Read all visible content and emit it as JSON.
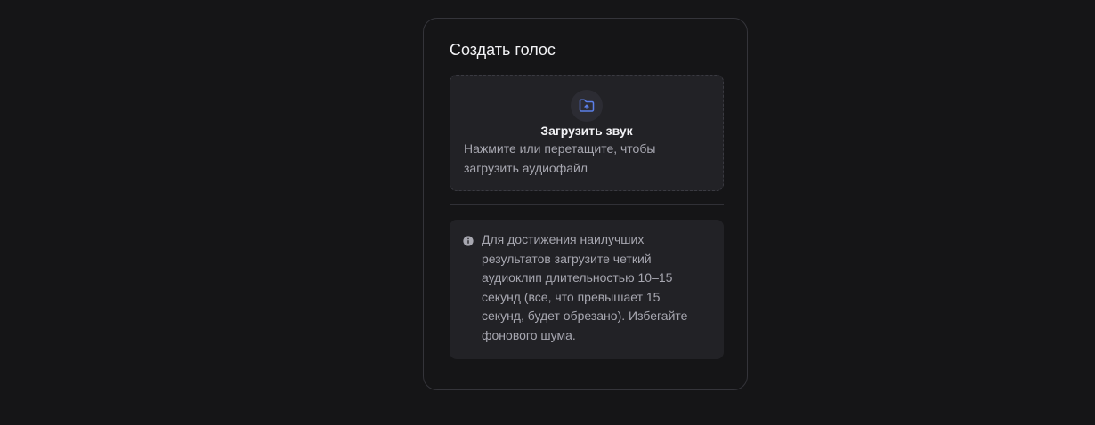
{
  "card": {
    "title": "Создать голос"
  },
  "upload": {
    "icon": "folder-upload-icon",
    "title": "Загрузить звук",
    "hint": "Нажмите или перетащите, чтобы загрузить аудиофайл"
  },
  "info": {
    "icon": "info-icon",
    "text": "Для достижения наилучших результатов загрузите четкий аудиоклип длительностью 10–15 секунд (все, что превышает 15 секунд, будет обрезано). Избегайте фонового шума."
  },
  "colors": {
    "background": "#151517",
    "card_border": "#34343a",
    "panel": "#222226",
    "accent_icon": "#5b7fe8",
    "text_primary": "#f2f2f5",
    "text_secondary": "#a7a7b0"
  }
}
